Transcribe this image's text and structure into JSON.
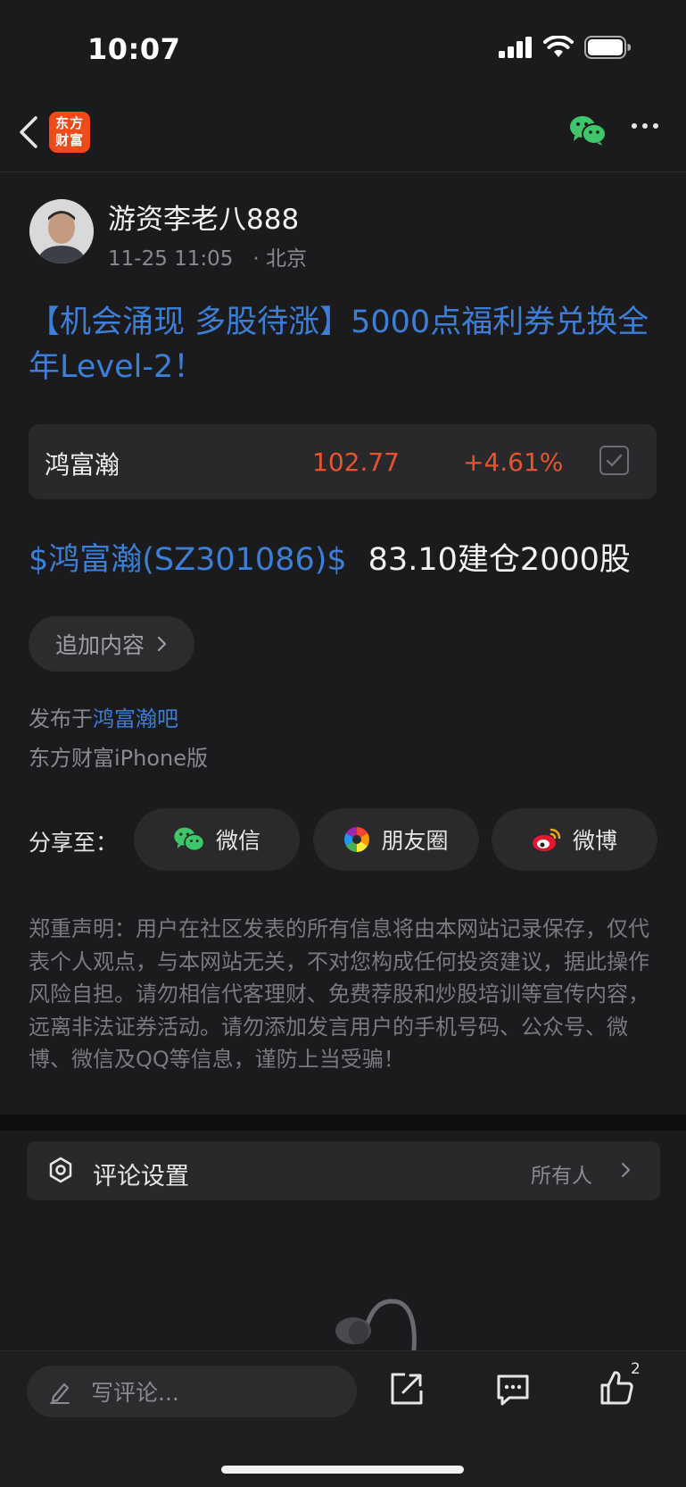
{
  "status_bar": {
    "time": "10:07",
    "icons": [
      "signal-icon",
      "wifi-icon",
      "battery-icon"
    ]
  },
  "nav": {
    "logo_line1": "东方",
    "logo_line2": "财富",
    "icons": [
      "back-icon",
      "wechat-icon",
      "more-icon"
    ]
  },
  "post": {
    "author": "游资李老八888",
    "date": "11-25 11:05",
    "location": "· 北京",
    "title": "【机会涌现 多股待涨】5000点福利券兑换全年Level-2！",
    "stock_card": {
      "name": "鸿富瀚",
      "price": "102.77",
      "change": "+4.61%"
    },
    "ticker": "$鸿富瀚(SZ301086)$",
    "body_text": "83.10建仓2000股",
    "append_label": "追加内容",
    "published_prefix": "发布于",
    "published_bar": "鸿富瀚吧",
    "client": "东方财富iPhone版"
  },
  "share": {
    "label": "分享至：",
    "wechat": "微信",
    "moments": "朋友圈",
    "weibo": "微博"
  },
  "disclaimer": "郑重声明：用户在社区发表的所有信息将由本网站记录保存，仅代表个人观点，与本网站无关，不对您构成任何投资建议，据此操作风险自担。请勿相信代客理财、免费荐股和炒股培训等宣传内容，远离非法证券活动。请勿添加发言用户的手机号码、公众号、微博、微信及QQ等信息，谨防上当受骗！",
  "comment_settings": {
    "label": "评论设置",
    "value": "所有人"
  },
  "bottom_bar": {
    "input_placeholder": "写评论...",
    "like_count": "2"
  },
  "colors": {
    "accent": "#3d7fd6",
    "rise": "#e8542d",
    "brand": "#f04a18",
    "background": "#1b1b1d"
  }
}
